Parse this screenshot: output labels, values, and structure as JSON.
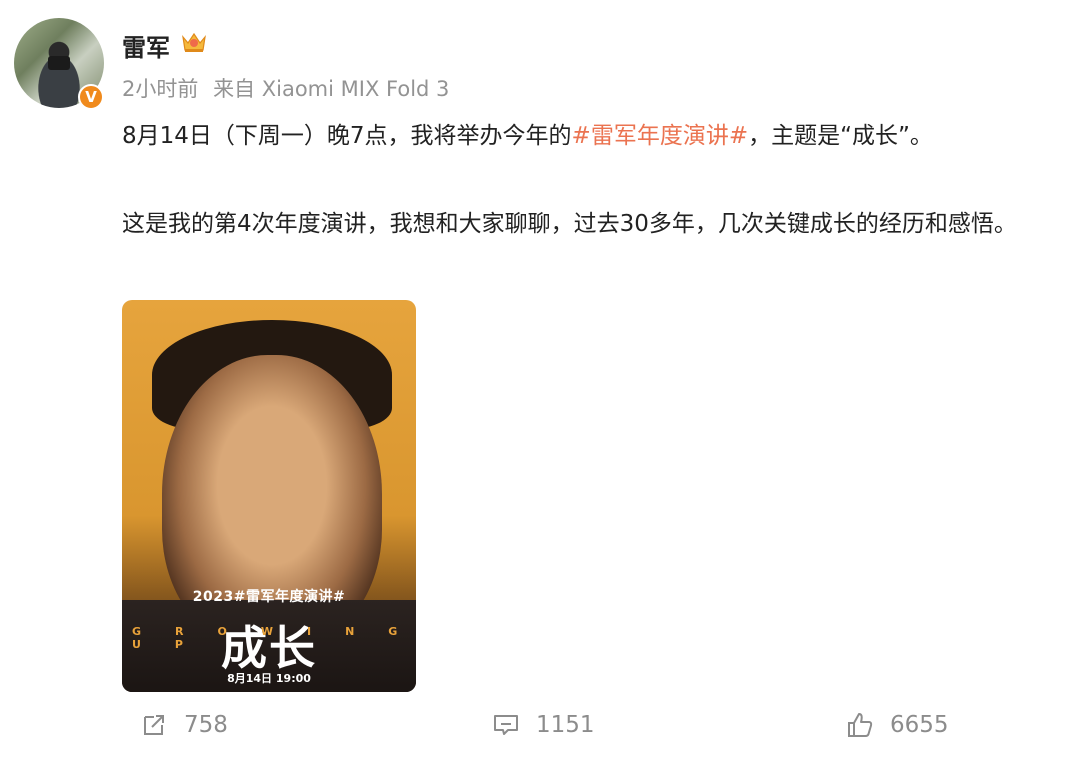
{
  "user": {
    "name": "雷军",
    "badge": "V",
    "accent": "#f08a1c"
  },
  "meta": {
    "time": "2小时前",
    "source": "来自 Xiaomi MIX Fold 3"
  },
  "post": {
    "para1_pre": "8月14日（下周一）晚7点，我将举办今年的",
    "hashtag": "#雷军年度演讲#",
    "para1_post": "，主题是“成长”。",
    "para2": "这是我的第4次年度演讲，我想和大家聊聊，过去30多年，几次关键成长的经历和感悟。",
    "hashtag_color": "#eb7350"
  },
  "poster": {
    "line1": "2023#雷军年度演讲#",
    "title": "成长",
    "subtitle": "GROWING UP",
    "date": "8月14日 19:00"
  },
  "actions": {
    "repost": {
      "icon": "share-icon",
      "count": "758"
    },
    "comment": {
      "icon": "comment-icon",
      "count": "1151"
    },
    "like": {
      "icon": "thumbs-up-icon",
      "count": "6655"
    }
  }
}
